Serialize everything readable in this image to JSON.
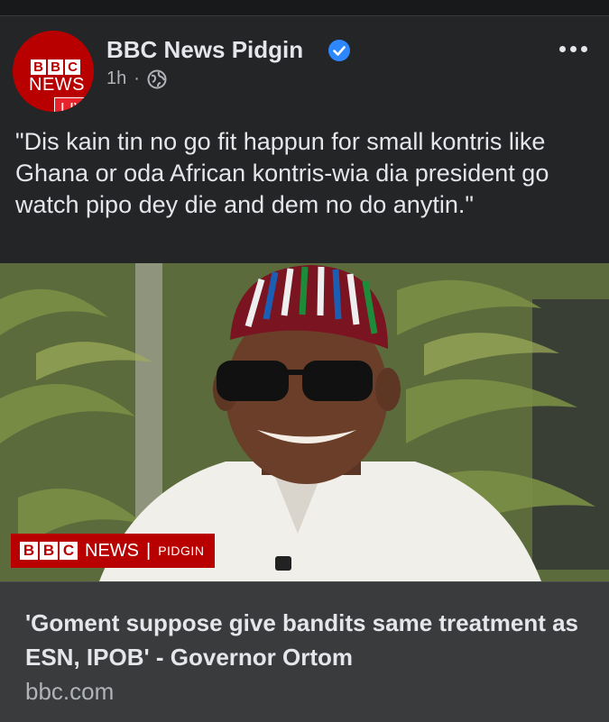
{
  "header": {
    "avatar": {
      "blocks": [
        "B",
        "B",
        "C"
      ],
      "news_word": "NEWS",
      "live_label": "LIVE"
    },
    "page_name": "BBC News Pidgin",
    "timestamp": "1h",
    "separator": "·",
    "verified_icon": "verified-badge-icon",
    "privacy_icon": "globe-icon",
    "more_icon": "more-options-icon"
  },
  "post": {
    "text": "\"Dis kain tin no go fit happun for small kontris like Ghana or oda African kontris-wia dia president go watch pipo dey die and dem no do anytin.\""
  },
  "image": {
    "watermark": {
      "blocks": [
        "B",
        "B",
        "C"
      ],
      "news": "NEWS",
      "separator": "|",
      "pidgin": "PIDGIN"
    }
  },
  "link": {
    "title": "'Goment suppose give bandits same treatment as ESN, IPOB' - Governor Ortom",
    "domain": "bbc.com"
  },
  "colors": {
    "background": "#242526",
    "card": "#3a3b3c",
    "bbc_red": "#b80000",
    "live_red": "#e8232c",
    "verified_blue": "#2d88ff",
    "secondary_text": "#b0b3b8"
  }
}
